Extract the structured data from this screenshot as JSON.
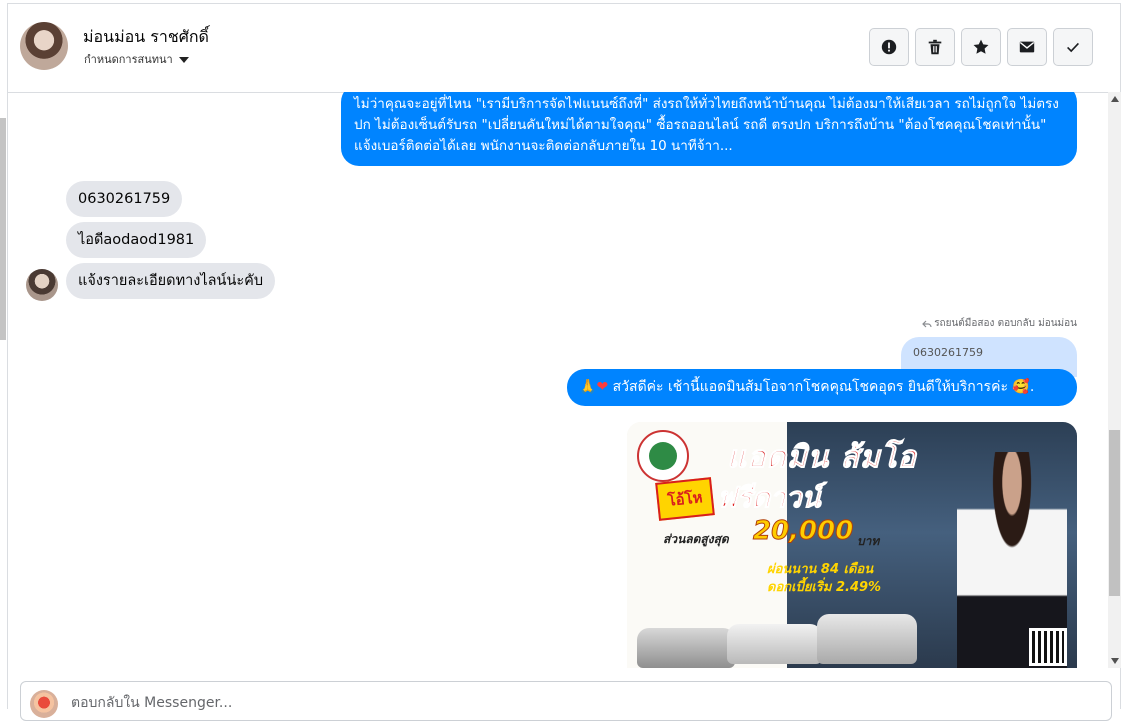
{
  "header": {
    "contact_name": "ม่อนม่อน ราชศักดิ์",
    "status": "กำหนดการสนทนา",
    "actions": [
      {
        "icon": "alert-icon"
      },
      {
        "icon": "trash-icon"
      },
      {
        "icon": "star-icon"
      },
      {
        "icon": "envelope-icon"
      },
      {
        "icon": "check-icon"
      }
    ]
  },
  "messages": {
    "outgoing_long": "ไม่ว่าคุณจะอยู่ที่ไหน \"เรามีบริการจัดไฟแนนซ์ถึงที่\"  ส่งรถให้ทั่วไทยถึงหน้าบ้านคุณ ไม่ต้องมาให้เสียเวลา รถไม่ถูกใจ ไม่ตรงปก ไม่ต้องเซ็นต์รับรถ \"เปลี่ยนคันใหม่ได้ตามใจคุณ\" ซื้อรถออนไลน์ รถดี ตรงปก บริการถึงบ้าน \"ต้องโชคคุณโชคเท่านั้น\" แจ้งเบอร์ติดต่อได้เลย พนักงานจะติดต่อกลับภายใน 10 นาทีจ้าา...",
    "incoming": [
      "0630261759",
      "ไอดีaodaod1981",
      "แจ้งรายละเอียดทางไลน์น่ะคับ"
    ],
    "reply_note": "รถยนต์มือสอง ตอบกลับ ม่อนม่อน",
    "quoted_text": "0630261759",
    "outgoing_reply_prefix": "🙏",
    "outgoing_reply_heart": "❤",
    "outgoing_reply_text": " สวัสดีค่ะ เช้านี้แอดมินส้มโอจากโชคคุณโชคอุดร ยินดีให้บริการค่ะ ",
    "outgoing_reply_suffix": "🥰."
  },
  "ad": {
    "title": "แอดมิน ส้มโอ",
    "badge": "โอ้โห",
    "headline": "ฟรีดาวน์",
    "discount_label": "ส่วนลดสูงสุด",
    "discount_amount": "20,000",
    "discount_unit": "บาท",
    "term": "ผ่อนนาน 84 เดือน",
    "interest": "ดอกเบี้ยเริ่ม 2.49%"
  },
  "composer": {
    "placeholder": "ตอบกลับใน Messenger..."
  },
  "colors": {
    "accent": "#0084ff",
    "incoming_bubble": "#e4e6eb",
    "quoted_bubble": "#cfe3ff"
  }
}
